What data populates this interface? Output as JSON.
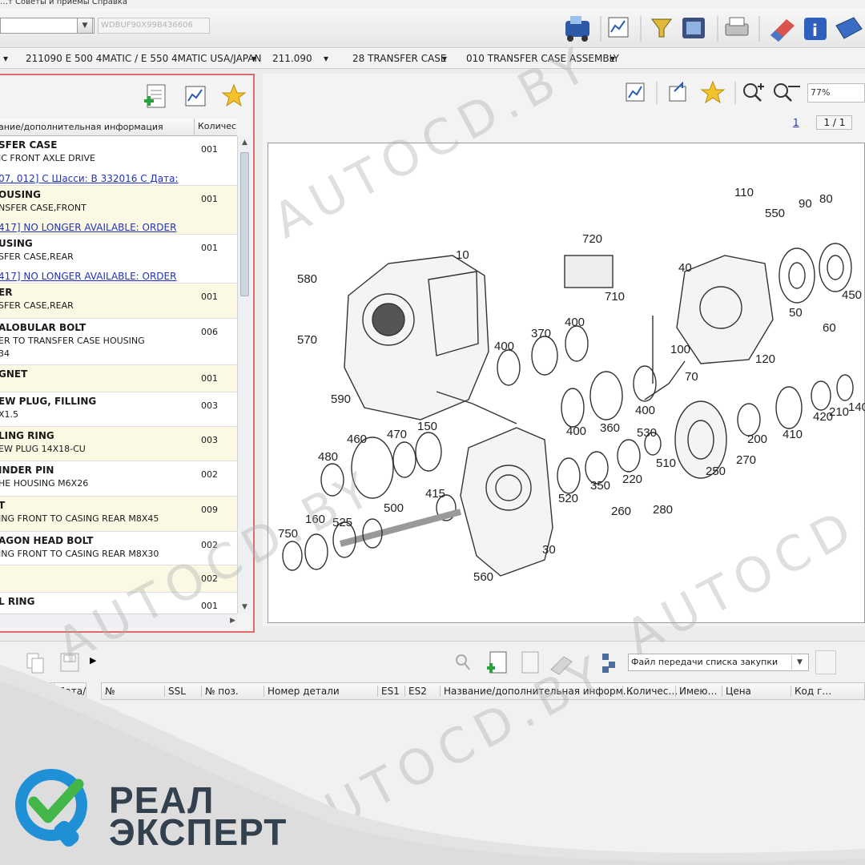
{
  "menubar": {
    "text": "…т   Советы и приемы   Справка"
  },
  "vin": "WDBUF90X99B436606",
  "breadcrumbs": [
    "211090 E 500 4MATIC / E 550 4MATIC USA/JAPAN",
    "211.090",
    "28 TRANSFER CASE",
    "010 TRANSFER CASE ASSEMBLY"
  ],
  "parts_table": {
    "col_name": "ание/дополнительная информация",
    "col_qty": "Количес",
    "rows": [
      {
        "name": "SFER CASE",
        "info": "IC FRONT AXLE DRIVE",
        "link": "07, 012] С Шасси: В 332016 С Дата:",
        "qty": "001",
        "yellow": false
      },
      {
        "name": "OUSING",
        "info": "NSFER CASE,FRONT",
        "link": "417] NO LONGER AVAILABLE: ORDER",
        "qty": "001",
        "yellow": true
      },
      {
        "name": "USING",
        "info": "SFER CASE,REAR",
        "link": "417] NO LONGER AVAILABLE: ORDER",
        "qty": "001",
        "yellow": false
      },
      {
        "name": "ER",
        "info": "SFER CASE,REAR",
        "link": "",
        "qty": "001",
        "yellow": true
      },
      {
        "name": "ALOBULAR BOLT",
        "info": "ER TO TRANSFER CASE HOUSING",
        "info2": "34",
        "link": "",
        "qty": "006",
        "yellow": false
      },
      {
        "name": "GNET",
        "info": "",
        "link": "",
        "qty": "001",
        "yellow": true
      },
      {
        "name": "EW PLUG, FILLING",
        "info": "X1.5",
        "link": "",
        "qty": "003",
        "yellow": false
      },
      {
        "name": "LING RING",
        "info": "EW PLUG 14X18-CU",
        "link": "",
        "qty": "003",
        "yellow": true
      },
      {
        "name": "INDER PIN",
        "info": "HE HOUSING M6X26",
        "link": "",
        "qty": "002",
        "yellow": false
      },
      {
        "name": "T",
        "info": "ING FRONT TO CASING REAR M8X45",
        "link": "",
        "qty": "009",
        "yellow": true
      },
      {
        "name": "AGON HEAD BOLT",
        "info": "ING FRONT TO CASING REAR M8X30",
        "link": "",
        "qty": "002",
        "yellow": false
      },
      {
        "name": "",
        "info": "",
        "link": "",
        "qty": "002",
        "yellow": true
      },
      {
        "name": "L RING",
        "info": "",
        "link": "",
        "qty": "001",
        "yellow": false
      }
    ]
  },
  "viewer": {
    "zoom": "77%",
    "page_link": "1",
    "page_count": "1 / 1",
    "callouts": [
      "110",
      "90",
      "80",
      "550",
      "720",
      "40",
      "50",
      "450",
      "60",
      "10",
      "580",
      "570",
      "710",
      "100",
      "120",
      "70",
      "400",
      "370",
      "400",
      "400",
      "590",
      "360",
      "400",
      "530",
      "200",
      "410",
      "420",
      "210",
      "140",
      "460",
      "470",
      "150",
      "480",
      "510",
      "270",
      "250",
      "520",
      "350",
      "220",
      "415",
      "280",
      "260",
      "500",
      "160",
      "525",
      "750",
      "30",
      "560"
    ]
  },
  "basket": {
    "file_select": "Файл передачи списка закупки",
    "left_cols": [
      "",
      "Дата/"
    ],
    "cols": [
      "№",
      "SSL",
      "№ поз.",
      "Номер детали",
      "ES1",
      "ES2",
      "Название/дополнительная информ…",
      "Количес…",
      "Имею…",
      "Цена",
      "Код г…"
    ]
  },
  "watermark": "AUTOCD.BY",
  "brand": {
    "line1": "РЕАЛ",
    "line2": "ЭКСПЕРТ",
    "blue": "#1f8fd6",
    "green": "#43b649"
  }
}
